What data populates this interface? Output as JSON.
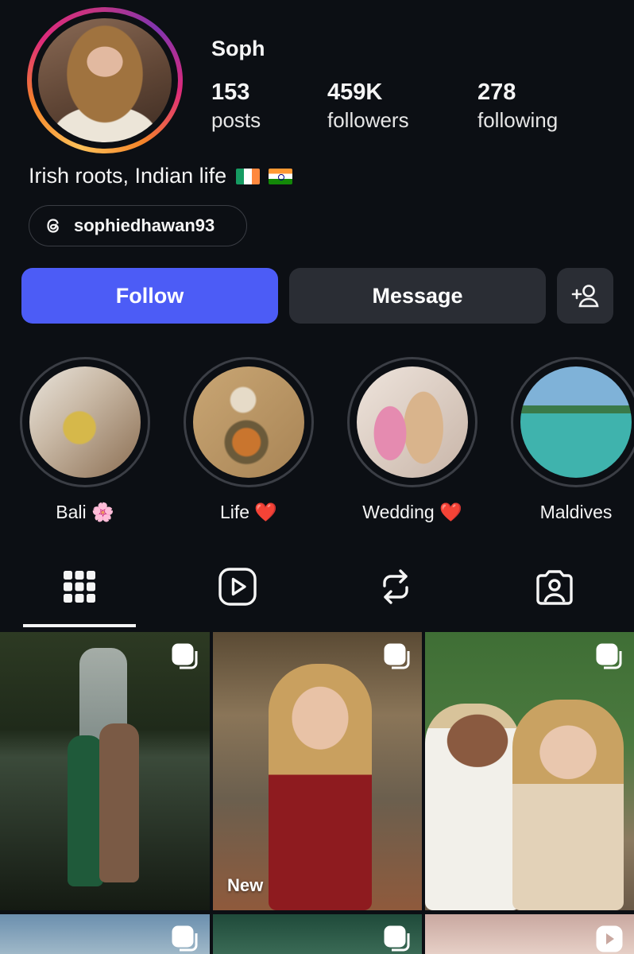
{
  "profile": {
    "username": "Soph",
    "stats": [
      {
        "value": "153",
        "label": "posts"
      },
      {
        "value": "459K",
        "label": "followers"
      },
      {
        "value": "278",
        "label": "following"
      }
    ],
    "bio": "Irish roots, Indian life",
    "bio_flags": [
      "flag-ireland",
      "flag-india"
    ],
    "threads_handle": "sophiedhawan93"
  },
  "actions": {
    "follow": "Follow",
    "message": "Message",
    "add_user_icon": "add-user-icon"
  },
  "highlights": [
    {
      "label": "Bali 🌸"
    },
    {
      "label": "Life ❤️"
    },
    {
      "label": "Wedding ❤️"
    },
    {
      "label": "Maldives"
    }
  ],
  "tabs": [
    {
      "icon": "grid-icon",
      "active": true
    },
    {
      "icon": "reels-icon",
      "active": false
    },
    {
      "icon": "reposts-icon",
      "active": false
    },
    {
      "icon": "tagged-icon",
      "active": false
    }
  ],
  "posts": [
    {
      "badge": "carousel-icon"
    },
    {
      "badge": "carousel-icon",
      "label": "New"
    },
    {
      "badge": "carousel-icon"
    },
    {
      "badge": "carousel-icon"
    },
    {
      "badge": "carousel-icon"
    },
    {
      "badge": "reel-icon"
    }
  ],
  "colors": {
    "background": "#0c0f14",
    "follow_button": "#4c5cf6",
    "secondary_button": "#2a2d34"
  }
}
